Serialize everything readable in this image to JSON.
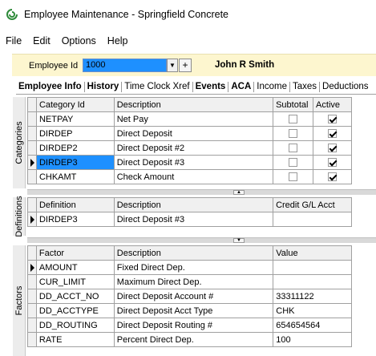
{
  "window": {
    "title": "Employee Maintenance - Springfield Concrete"
  },
  "menu": [
    "File",
    "Edit",
    "Options",
    "Help"
  ],
  "employee": {
    "label": "Employee Id",
    "id_value": "1000",
    "name": "John R Smith",
    "add_symbol": "+"
  },
  "tabs": [
    {
      "label": "Employee Info",
      "bold": true
    },
    {
      "label": "History",
      "bold": true
    },
    {
      "label": "Time Clock Xref",
      "bold": false
    },
    {
      "label": "Events",
      "bold": true
    },
    {
      "label": "ACA",
      "bold": true
    },
    {
      "label": "Income",
      "bold": false
    },
    {
      "label": "Taxes",
      "bold": false
    },
    {
      "label": "Deductions",
      "bold": false
    }
  ],
  "categories": {
    "side_label": "Categories",
    "headers": {
      "id": "Category Id",
      "desc": "Description",
      "subtotal": "Subtotal",
      "active": "Active"
    },
    "rows": [
      {
        "id": "NETPAY",
        "desc": "Net Pay",
        "subtotal": false,
        "active": true
      },
      {
        "id": "DIRDEP",
        "desc": "Direct Deposit",
        "subtotal": false,
        "active": true
      },
      {
        "id": "DIRDEP2",
        "desc": "Direct Deposit #2",
        "subtotal": false,
        "active": true
      },
      {
        "id": "DIRDEP3",
        "desc": "Direct Deposit #3",
        "subtotal": false,
        "active": true
      },
      {
        "id": "CHKAMT",
        "desc": "Check Amount",
        "subtotal": false,
        "active": true
      }
    ]
  },
  "definitions": {
    "side_label": "Definitions",
    "headers": {
      "def": "Definition",
      "desc": "Description",
      "gl": "Credit G/L Acct"
    },
    "rows": [
      {
        "def": "DIRDEP3",
        "desc": "Direct Deposit #3",
        "gl": ""
      }
    ]
  },
  "factors": {
    "side_label": "Factors",
    "headers": {
      "factor": "Factor",
      "desc": "Description",
      "value": "Value"
    },
    "rows": [
      {
        "factor": "AMOUNT",
        "desc": "Fixed Direct Dep.",
        "value": ""
      },
      {
        "factor": "CUR_LIMIT",
        "desc": "Maximum Direct Dep.",
        "value": ""
      },
      {
        "factor": "DD_ACCT_NO",
        "desc": "Direct Deposit Account #",
        "value": "33311122"
      },
      {
        "factor": "DD_ACCTYPE",
        "desc": "Direct Deposit Acct Type",
        "value": "CHK"
      },
      {
        "factor": "DD_ROUTING",
        "desc": "Direct Deposit Routing #",
        "value": "654654564"
      },
      {
        "factor": "RATE",
        "desc": "Percent Direct Dep.",
        "value": "100"
      }
    ]
  },
  "colors": {
    "selection": "#1e90ff",
    "header_strip": "#fdf6cf"
  }
}
